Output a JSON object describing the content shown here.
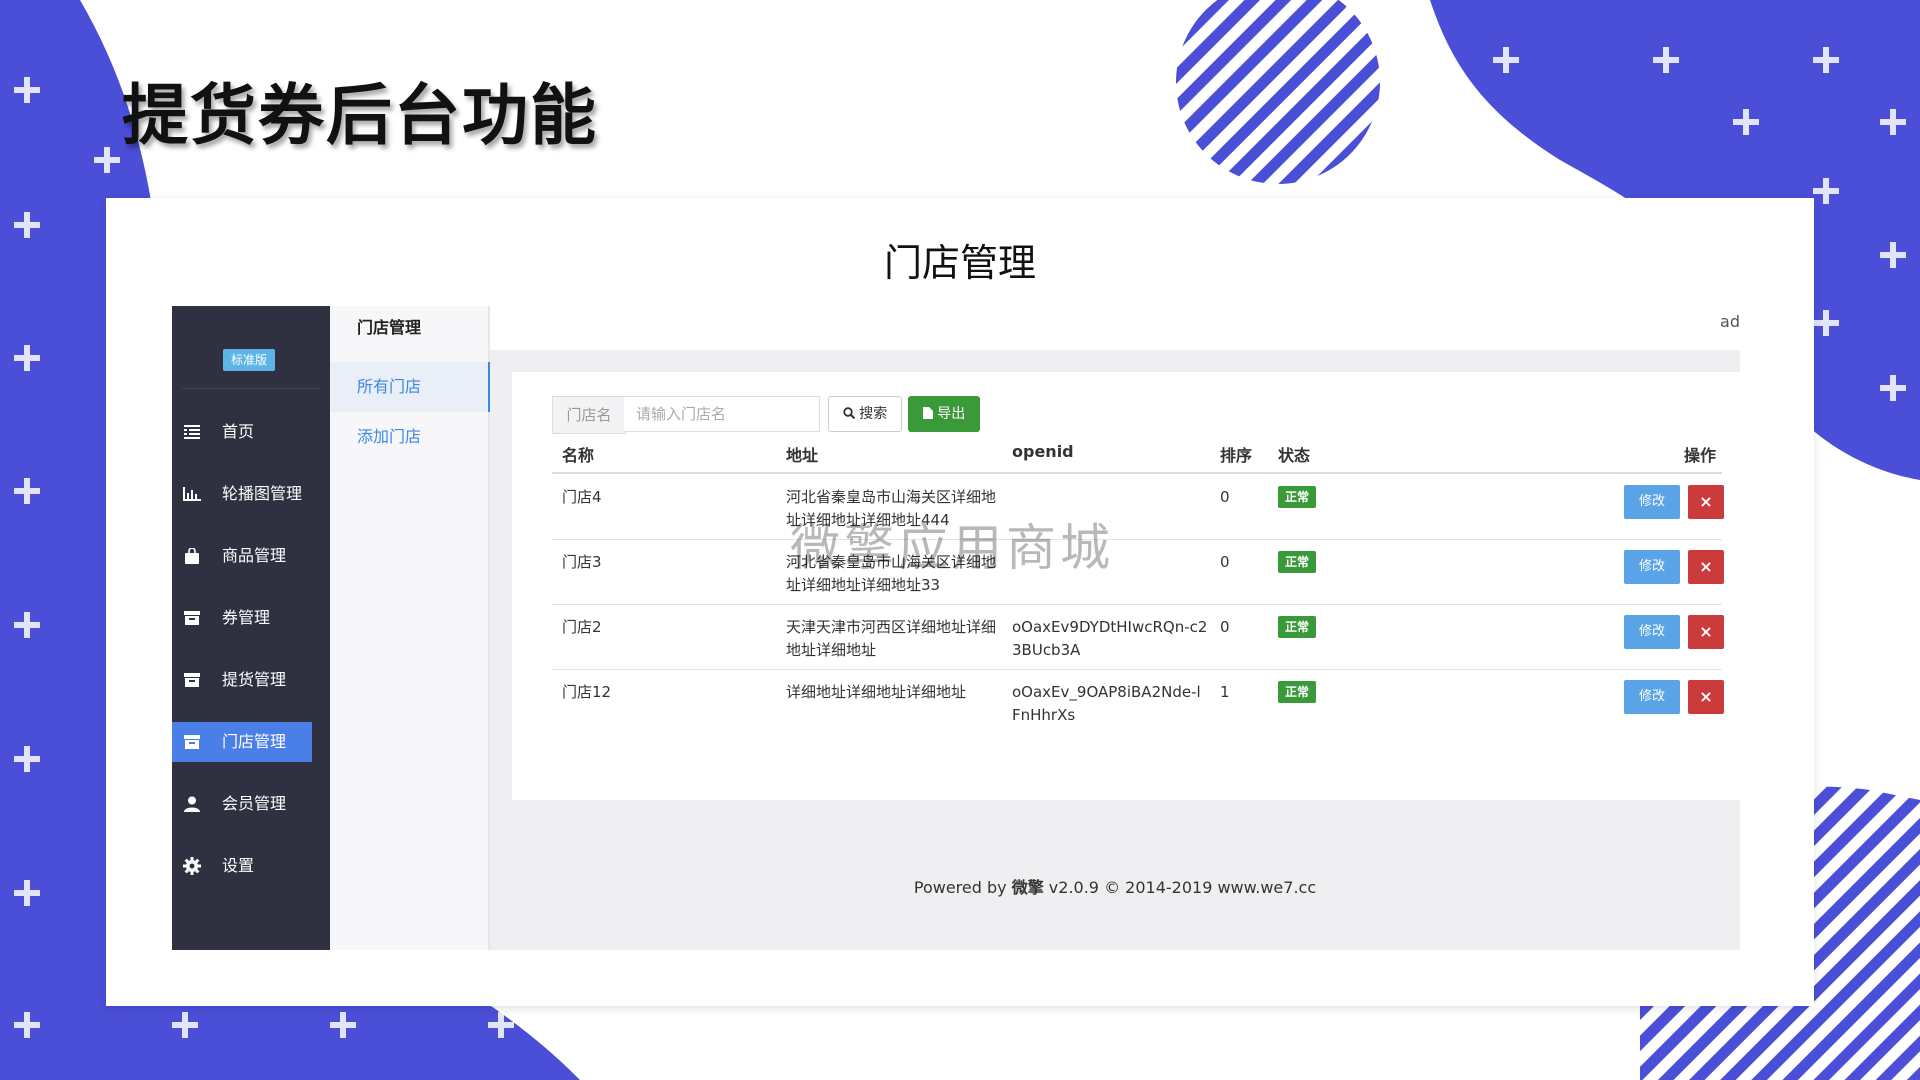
{
  "slide": {
    "title": "提货券后台功能"
  },
  "card": {
    "title": "门店管理"
  },
  "sidebar": {
    "edition_badge": "标准版",
    "items": [
      {
        "label": "首页",
        "icon": "list-icon"
      },
      {
        "label": "轮播图管理",
        "icon": "bar-chart-icon"
      },
      {
        "label": "商品管理",
        "icon": "shopping-bag-icon"
      },
      {
        "label": "券管理",
        "icon": "archive-icon"
      },
      {
        "label": "提货管理",
        "icon": "archive-icon"
      },
      {
        "label": "门店管理",
        "icon": "archive-icon",
        "active": true
      },
      {
        "label": "会员管理",
        "icon": "user-icon"
      },
      {
        "label": "设置",
        "icon": "gear-icon"
      }
    ]
  },
  "subnav": {
    "title": "门店管理",
    "items": [
      {
        "label": "所有门店",
        "active": true
      },
      {
        "label": "添加门店"
      }
    ]
  },
  "topbar": {
    "user": "ad"
  },
  "search": {
    "addon_label": "门店名",
    "placeholder": "请输入门店名",
    "search_button": "搜索",
    "export_button": "导出"
  },
  "table": {
    "headers": {
      "name": "名称",
      "address": "地址",
      "openid": "openid",
      "sort": "排序",
      "status": "状态",
      "actions": "操作"
    },
    "rows": [
      {
        "name": "门店4",
        "address": "河北省秦皇岛市山海关区详细地址详细地址详细地址444",
        "openid": "",
        "sort": "0",
        "status": "正常"
      },
      {
        "name": "门店3",
        "address": "河北省秦皇岛市山海关区详细地址详细地址详细地址33",
        "openid": "",
        "sort": "0",
        "status": "正常"
      },
      {
        "name": "门店2",
        "address": "天津天津市河西区详细地址详细地址详细地址",
        "openid": "oOaxEv9DYDtHIwcRQn-c23BUcb3A",
        "sort": "0",
        "status": "正常"
      },
      {
        "name": "门店12",
        "address": "详细地址详细地址详细地址",
        "openid": "oOaxEv_9OAP8iBA2Nde-lFnHhrXs",
        "sort": "1",
        "status": "正常"
      }
    ],
    "edit_label": "修改",
    "delete_label": "×"
  },
  "footer": {
    "prefix": "Powered by ",
    "brand": "微擎",
    "suffix": " v2.0.9 © 2014-2019 www.we7.cc"
  },
  "watermark": "微擎应用商城",
  "colors": {
    "accent_blue": "#4b4fd8",
    "sidebar_bg": "#2f3140",
    "active_item": "#4a7fe8",
    "success": "#3a9a3a",
    "danger": "#cc3b3b"
  }
}
